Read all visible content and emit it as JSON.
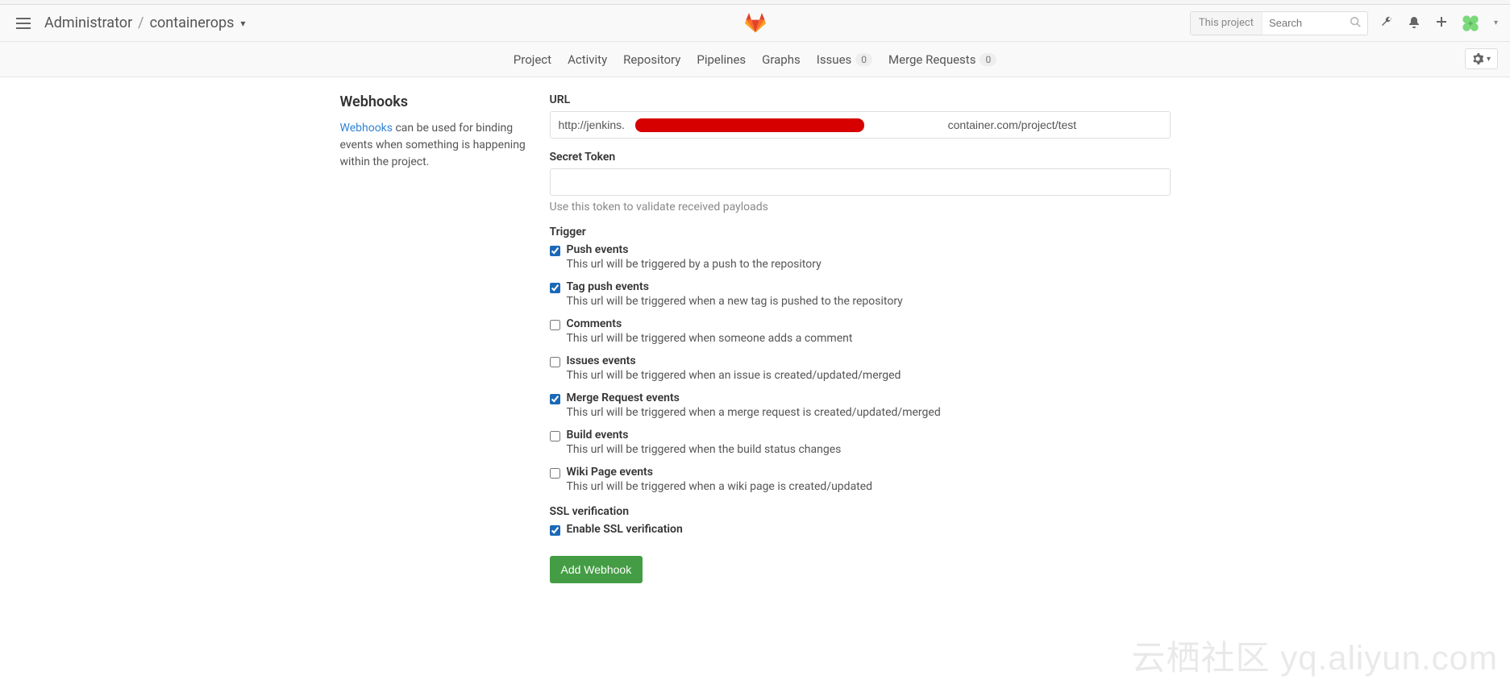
{
  "breadcrumb": {
    "owner": "Administrator",
    "project": "containerops"
  },
  "search": {
    "scope": "This project",
    "placeholder": "Search"
  },
  "nav": {
    "project": "Project",
    "activity": "Activity",
    "repository": "Repository",
    "pipelines": "Pipelines",
    "graphs": "Graphs",
    "issues": "Issues",
    "issues_count": "0",
    "merge_requests": "Merge Requests",
    "mr_count": "0"
  },
  "sidebar": {
    "title": "Webhooks",
    "link_text": "Webhooks",
    "desc_rest": " can be used for binding events when something is happening within the project."
  },
  "form": {
    "url_label": "URL",
    "url_value": "http://jenkins.                                                                                                       container.com/project/test",
    "secret_label": "Secret Token",
    "secret_value": "",
    "secret_help": "Use this token to validate received payloads",
    "trigger_label": "Trigger",
    "ssl_label": "SSL verification",
    "ssl_check_label": "Enable SSL verification",
    "submit": "Add Webhook"
  },
  "triggers": [
    {
      "label": "Push events",
      "desc": "This url will be triggered by a push to the repository",
      "checked": true
    },
    {
      "label": "Tag push events",
      "desc": "This url will be triggered when a new tag is pushed to the repository",
      "checked": true
    },
    {
      "label": "Comments",
      "desc": "This url will be triggered when someone adds a comment",
      "checked": false
    },
    {
      "label": "Issues events",
      "desc": "This url will be triggered when an issue is created/updated/merged",
      "checked": false
    },
    {
      "label": "Merge Request events",
      "desc": "This url will be triggered when a merge request is created/updated/merged",
      "checked": true
    },
    {
      "label": "Build events",
      "desc": "This url will be triggered when the build status changes",
      "checked": false
    },
    {
      "label": "Wiki Page events",
      "desc": "This url will be triggered when a wiki page is created/updated",
      "checked": false
    }
  ],
  "watermark": "云栖社区 yq.aliyun.com"
}
